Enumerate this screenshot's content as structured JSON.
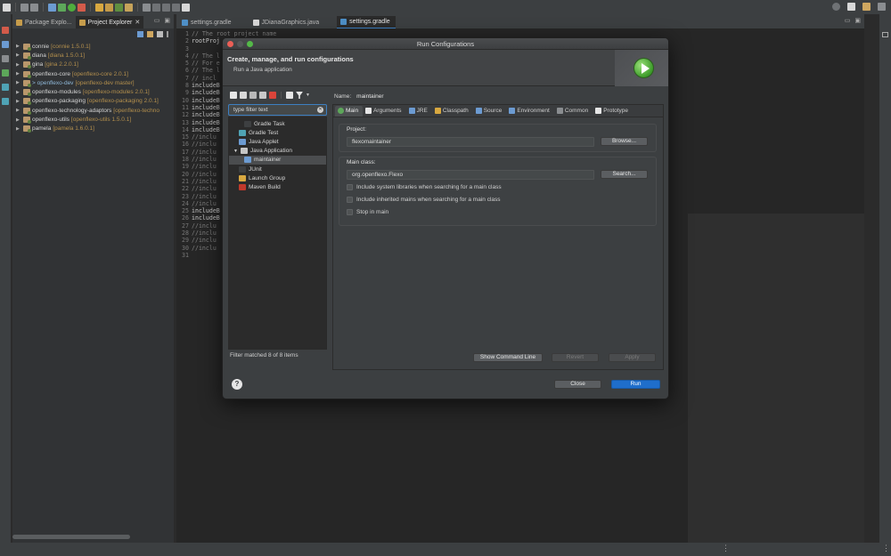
{
  "explorer": {
    "tabs": [
      {
        "label": "Package Explo...",
        "active": false
      },
      {
        "label": "Project Explorer",
        "active": true
      }
    ],
    "projects": [
      {
        "name": "connie",
        "meta": "[connie 1.5.0.1]",
        "modified": false
      },
      {
        "name": "diana",
        "meta": "[diana 1.5.0.1]",
        "modified": false
      },
      {
        "name": "gina",
        "meta": "[gina 2.2.0.1]",
        "modified": false
      },
      {
        "name": "openflexo-core",
        "meta": "[openflexo-core 2.0.1]",
        "modified": false
      },
      {
        "name": "> openflexo-dev",
        "meta": "[openflexo-dev master]",
        "modified": true
      },
      {
        "name": "openflexo-modules",
        "meta": "[openflexo-modules 2.0.1]",
        "modified": false
      },
      {
        "name": "openflexo-packaging",
        "meta": "[openflexo-packaging 2.0.1]",
        "modified": false
      },
      {
        "name": "openflexo-technology-adaptors",
        "meta": "[openflexo-techno",
        "modified": false
      },
      {
        "name": "openflexo-utils",
        "meta": "[openflexo-utils 1.5.0.1]",
        "modified": false
      },
      {
        "name": "pamela",
        "meta": "[pamela 1.6.0.1]",
        "modified": false
      }
    ]
  },
  "editor": {
    "tabs": [
      {
        "label": "settings.gradle",
        "icon": "gradle-file-icon",
        "active": false
      },
      {
        "label": "JDianaGraphics.java",
        "icon": "java-file-icon",
        "active": false
      },
      {
        "label": "settings.gradle",
        "icon": "gradle-file-icon",
        "active": true
      }
    ],
    "lines": [
      {
        "n": "1",
        "t": "// The root project name",
        "c": true
      },
      {
        "n": "2",
        "t": "rootProj",
        "c": false
      },
      {
        "n": "3",
        "t": "",
        "c": false
      },
      {
        "n": "4",
        "t": "// The l",
        "c": true
      },
      {
        "n": "5",
        "t": "// For e",
        "c": true
      },
      {
        "n": "6",
        "t": "// The l",
        "c": true
      },
      {
        "n": "7",
        "t": "// incl",
        "c": true
      },
      {
        "n": "8",
        "t": "includeB",
        "c": false
      },
      {
        "n": "9",
        "t": "includeB",
        "c": false
      },
      {
        "n": "10",
        "t": "includeB",
        "c": false
      },
      {
        "n": "11",
        "t": "includeB",
        "c": false
      },
      {
        "n": "12",
        "t": "includeB",
        "c": false
      },
      {
        "n": "13",
        "t": "includeB",
        "c": false
      },
      {
        "n": "14",
        "t": "includeB",
        "c": false
      },
      {
        "n": "15",
        "t": "//inclu",
        "c": true
      },
      {
        "n": "16",
        "t": "//inclu",
        "c": true
      },
      {
        "n": "17",
        "t": "//inclu",
        "c": true
      },
      {
        "n": "18",
        "t": "//inclu",
        "c": true
      },
      {
        "n": "19",
        "t": "//inclu",
        "c": true
      },
      {
        "n": "20",
        "t": "//inclu",
        "c": true
      },
      {
        "n": "21",
        "t": "//inclu",
        "c": true
      },
      {
        "n": "22",
        "t": "//inclu",
        "c": true
      },
      {
        "n": "23",
        "t": "//inclu",
        "c": true
      },
      {
        "n": "24",
        "t": "//inclu",
        "c": true
      },
      {
        "n": "25",
        "t": "includeB",
        "c": false
      },
      {
        "n": "26",
        "t": "includeB",
        "c": false
      },
      {
        "n": "27",
        "t": "//inclu",
        "c": true
      },
      {
        "n": "28",
        "t": "//inclu",
        "c": true
      },
      {
        "n": "29",
        "t": "//inclu",
        "c": true
      },
      {
        "n": "30",
        "t": "//inclu",
        "c": true
      },
      {
        "n": "31",
        "t": "",
        "c": false
      }
    ],
    "overflow_text": "ctory"
  },
  "dialog": {
    "title": "Run Configurations",
    "header_title": "Create, manage, and run configurations",
    "header_subtitle": "Run a Java application",
    "filter_placeholder": "type filter text",
    "filter_value": "type filter text",
    "config_types": [
      {
        "label": "Gradle Task",
        "icon": "gradle-task-icon",
        "indent": 2,
        "selected": false,
        "arrow": ""
      },
      {
        "label": "Gradle Test",
        "icon": "gradle-test-icon",
        "indent": 1,
        "selected": false,
        "arrow": ""
      },
      {
        "label": "Java Applet",
        "icon": "java-applet-icon",
        "indent": 1,
        "selected": false,
        "arrow": ""
      },
      {
        "label": "Java Application",
        "icon": "java-application-icon",
        "indent": 0,
        "selected": false,
        "arrow": "▼"
      },
      {
        "label": "maintainer",
        "icon": "java-launch-icon",
        "indent": 2,
        "selected": true,
        "arrow": ""
      },
      {
        "label": "JUnit",
        "icon": "junit-icon",
        "indent": 1,
        "selected": false,
        "arrow": ""
      },
      {
        "label": "Launch Group",
        "icon": "launch-group-icon",
        "indent": 1,
        "selected": false,
        "arrow": ""
      },
      {
        "label": "Maven Build",
        "icon": "maven-build-icon",
        "indent": 1,
        "selected": false,
        "arrow": ""
      }
    ],
    "filter_status": "Filter matched 8 of 8 items",
    "name_label": "Name:",
    "name_value": "maintainer",
    "tabs": [
      {
        "label": "Main",
        "icon": "main-tab-icon",
        "active": true
      },
      {
        "label": "Arguments",
        "icon": "arguments-tab-icon",
        "active": false
      },
      {
        "label": "JRE",
        "icon": "jre-tab-icon",
        "active": false
      },
      {
        "label": "Classpath",
        "icon": "classpath-tab-icon",
        "active": false
      },
      {
        "label": "Source",
        "icon": "source-tab-icon",
        "active": false
      },
      {
        "label": "Environment",
        "icon": "environment-tab-icon",
        "active": false
      },
      {
        "label": "Common",
        "icon": "common-tab-icon",
        "active": false
      },
      {
        "label": "Prototype",
        "icon": "prototype-tab-icon",
        "active": false
      }
    ],
    "project_label": "Project:",
    "project_value": "flexomaintainer",
    "browse_label": "Browse...",
    "main_class_label": "Main class:",
    "main_class_value": "org.openflexo.Flexo",
    "search_label": "Search...",
    "options": [
      {
        "label": "Include system libraries when searching for a main class",
        "checked": false
      },
      {
        "label": "Include inherited mains when searching for a main class",
        "checked": false
      },
      {
        "label": "Stop in main",
        "checked": false
      }
    ],
    "show_command_line": "Show Command Line",
    "revert": "Revert",
    "apply": "Apply",
    "close": "Close",
    "run": "Run",
    "help": "?"
  },
  "colors": {
    "accent": "#1f6ecb",
    "focus": "#3d7fc1",
    "run_green": "#3d9b2a"
  }
}
